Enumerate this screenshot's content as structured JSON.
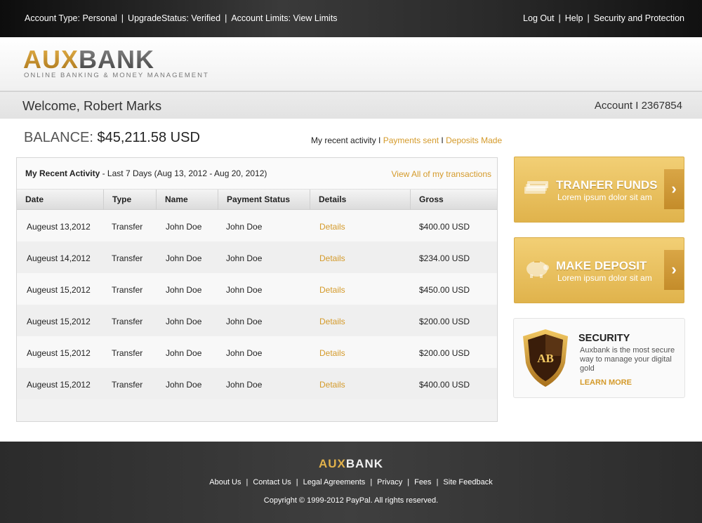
{
  "topbar": {
    "account_type": "Account Type: Personal",
    "upgrade_status": "UpgradeStatus: Verified",
    "account_limits": "Account Limits: View Limits",
    "logout": "Log Out",
    "help": "Help",
    "security": "Security and Protection",
    "separator": "|"
  },
  "header": {
    "logo_aux": "AUX",
    "logo_bank": "BANK",
    "tagline": "ONLINE BANKING & MONEY MANAGEMENT"
  },
  "welcome": {
    "greeting": "Welcome, Robert Marks",
    "account": "Account I 2367854"
  },
  "balance": {
    "label": "BALANCE:",
    "value": "$45,211.58 USD"
  },
  "activity_links": {
    "recent": "My recent activity",
    "sep": " I ",
    "payments": "Payments sent",
    "deposits": "Deposits Made"
  },
  "panel": {
    "title_bold": "My Recent Activity",
    "title_rest": " - Last 7 Days (Aug 13, 2012 - Aug 20, 2012)",
    "view_all": "View All of my transactions",
    "columns": [
      "Date",
      "Type",
      "Name",
      "Payment Status",
      "Details",
      "Gross"
    ],
    "rows": [
      [
        "Augeust 13,2012",
        "Transfer",
        "John Doe",
        "John Doe",
        "Details",
        "$400.00 USD"
      ],
      [
        "Augeust 14,2012",
        "Transfer",
        "John Doe",
        "John Doe",
        "Details",
        "$234.00 USD"
      ],
      [
        "Augeust 15,2012",
        "Transfer",
        "John Doe",
        "John Doe",
        "Details",
        "$450.00 USD"
      ],
      [
        "Augeust 15,2012",
        "Transfer",
        "John Doe",
        "John Doe",
        "Details",
        "$200.00 USD"
      ],
      [
        "Augeust 15,2012",
        "Transfer",
        "John Doe",
        "John Doe",
        "Details",
        "$200.00 USD"
      ],
      [
        "Augeust 15,2012",
        "Transfer",
        "John Doe",
        "John Doe",
        "Details",
        "$400.00 USD"
      ]
    ]
  },
  "cards": {
    "transfer": {
      "title": "TRANFER FUNDS",
      "subtitle": "Lorem ipsum dolor sit am",
      "icon": "money-stack-icon"
    },
    "deposit": {
      "title": "MAKE DEPOSIT",
      "subtitle": "Lorem ipsum dolor sit am",
      "icon": "piggy-bank-icon"
    }
  },
  "security_box": {
    "title": "SECURITY",
    "text": "Auxbank is the most secure way to manage your digital gold",
    "link": "LEARN MORE",
    "badge_text": "AB"
  },
  "footer": {
    "logo_aux": "AUX",
    "logo_bank": "BANK",
    "links": [
      "About Us",
      "Contact Us",
      "Legal Agreements",
      "Privacy",
      "Fees",
      "Site Feedback"
    ],
    "copyright": "Copyright © 1999-2012 PayPal. All rights reserved."
  },
  "colors": {
    "accent_gold": "#d49a2a",
    "topbar_dark": "#1a1a1a",
    "footer_dark": "#333333"
  }
}
